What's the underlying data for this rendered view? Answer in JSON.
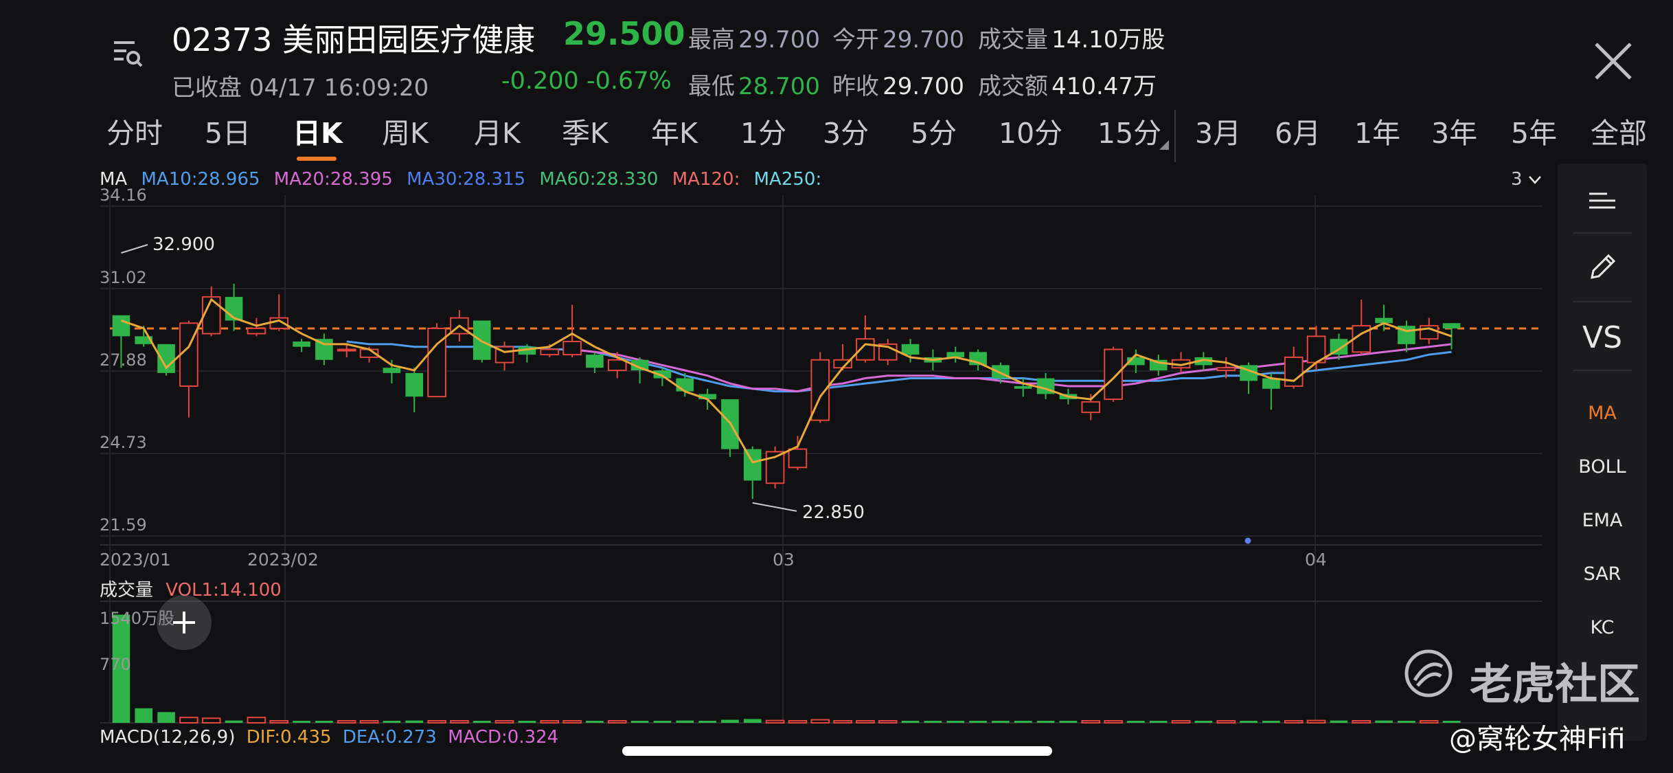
{
  "header": {
    "stock_title": "02373 美丽田园医疗健康",
    "price": "29.500",
    "status": "已收盘 04/17 16:09:20",
    "change": "-0.200  -0.67%",
    "high_label": "最高",
    "high_value": "29.700",
    "open_label": "今开",
    "open_value": "29.700",
    "volume_label": "成交量",
    "volume_value": "14.10万股",
    "low_label": "最低",
    "low_value": "28.700",
    "prev_close_label": "昨收",
    "prev_close_value": "29.700",
    "turnover_label": "成交额",
    "turnover_value": "410.47万",
    "icons": {
      "menu": "search-list-icon",
      "close": "close-icon"
    }
  },
  "tabs": [
    {
      "label": "分时"
    },
    {
      "label": "5日"
    },
    {
      "label": "日K",
      "active": true
    },
    {
      "label": "周K"
    },
    {
      "label": "月K"
    },
    {
      "label": "季K"
    },
    {
      "label": "年K"
    },
    {
      "label": "1分"
    },
    {
      "label": "3分"
    },
    {
      "label": "5分"
    },
    {
      "label": "10分"
    },
    {
      "label": "15分"
    },
    {
      "label": "3月"
    },
    {
      "label": "6月"
    },
    {
      "label": "1年"
    },
    {
      "label": "3年"
    },
    {
      "label": "5年"
    },
    {
      "label": "全部"
    }
  ],
  "ma_legend": {
    "label": "MA",
    "ma10": "MA10:28.965",
    "ma20": "MA20:28.395",
    "ma30": "MA30:28.315",
    "ma60": "MA60:28.330",
    "ma120": "MA120:",
    "ma250": "MA250:",
    "menu": "3",
    "colors": {
      "ma10": "#e8a93a",
      "ma20": "#d86ad8",
      "ma30": "#4f8fe8",
      "ma60": "#45c07a",
      "ma120": "#f06a6a",
      "ma250": "#6fd8e8"
    }
  },
  "tools": [
    {
      "label": "",
      "icon": "list-icon"
    },
    {
      "label": "",
      "icon": "pencil-icon"
    },
    {
      "label": "VS"
    },
    {
      "label": "MA",
      "active": true
    },
    {
      "label": "BOLL"
    },
    {
      "label": "EMA"
    },
    {
      "label": "SAR"
    },
    {
      "label": "KC"
    }
  ],
  "volume": {
    "label": "成交量",
    "vol1": "VOL1:14.100",
    "top_tick": "1540万股",
    "mid_tick": "770"
  },
  "macd": {
    "label": "MACD(12,26,9)",
    "dif": "DIF:0.435",
    "dea": "DEA:0.273",
    "macd": "MACD:0.324"
  },
  "watermark": "老虎社区",
  "credit": "@窝轮女神Fifi",
  "colors": {
    "up": "#e2463f",
    "down": "#2fb44a",
    "accent": "#f07a25",
    "background": "#111113"
  },
  "chart_data": {
    "type": "candlestick",
    "y_ticks": [
      "34.16",
      "31.02",
      "27.88",
      "24.73",
      "21.59"
    ],
    "ylim": [
      21.59,
      34.16
    ],
    "x_ticks": [
      "2023/01",
      "2023/02",
      "03",
      "04"
    ],
    "current_price_line": 29.5,
    "annotations": {
      "high": "32.900",
      "low": "22.850"
    },
    "candles": [
      [
        30.0,
        29.2,
        30.0,
        28.0
      ],
      [
        29.2,
        28.9,
        29.6,
        28.8
      ],
      [
        28.9,
        27.8,
        28.9,
        27.7
      ],
      [
        27.3,
        29.7,
        29.8,
        26.1
      ],
      [
        29.3,
        30.7,
        31.1,
        29.2
      ],
      [
        30.7,
        29.8,
        31.2,
        29.4
      ],
      [
        29.3,
        29.5,
        29.9,
        29.2
      ],
      [
        29.5,
        29.9,
        30.8,
        29.4
      ],
      [
        29.0,
        28.8,
        29.1,
        28.6
      ],
      [
        29.1,
        28.3,
        29.3,
        28.1
      ],
      [
        28.7,
        28.7,
        28.9,
        28.4
      ],
      [
        28.4,
        28.7,
        28.8,
        28.2
      ],
      [
        28.0,
        27.8,
        28.3,
        27.4
      ],
      [
        27.8,
        26.9,
        28.0,
        26.3
      ],
      [
        26.9,
        29.5,
        29.7,
        26.9
      ],
      [
        29.3,
        29.9,
        30.2,
        29.0
      ],
      [
        29.8,
        28.3,
        29.8,
        28.2
      ],
      [
        28.2,
        28.8,
        29.0,
        27.9
      ],
      [
        28.8,
        28.5,
        28.9,
        28.2
      ],
      [
        28.5,
        28.7,
        28.9,
        28.4
      ],
      [
        28.5,
        29.0,
        30.4,
        28.4
      ],
      [
        28.5,
        28.0,
        28.6,
        27.8
      ],
      [
        27.9,
        28.3,
        28.6,
        27.6
      ],
      [
        28.3,
        27.9,
        28.4,
        27.4
      ],
      [
        27.9,
        27.6,
        28.0,
        27.3
      ],
      [
        27.6,
        27.1,
        27.8,
        26.9
      ],
      [
        27.0,
        26.8,
        27.2,
        26.4
      ],
      [
        26.8,
        24.9,
        26.8,
        24.6
      ],
      [
        24.9,
        23.7,
        25.0,
        23.0
      ],
      [
        23.6,
        24.8,
        25.0,
        23.4
      ],
      [
        24.2,
        24.9,
        25.4,
        24.1
      ],
      [
        26.0,
        28.3,
        28.6,
        25.9
      ],
      [
        28.0,
        28.3,
        28.9,
        27.9
      ],
      [
        28.3,
        29.1,
        30.0,
        28.2
      ],
      [
        28.3,
        28.9,
        29.1,
        28.1
      ],
      [
        28.9,
        28.5,
        29.1,
        28.2
      ],
      [
        28.4,
        28.2,
        28.7,
        27.9
      ],
      [
        28.6,
        28.4,
        28.8,
        28.2
      ],
      [
        28.6,
        28.1,
        28.7,
        27.9
      ],
      [
        28.1,
        27.6,
        28.2,
        27.4
      ],
      [
        27.3,
        27.2,
        27.6,
        26.9
      ],
      [
        27.6,
        27.0,
        27.8,
        26.8
      ],
      [
        27.0,
        26.8,
        27.2,
        26.6
      ],
      [
        26.3,
        26.7,
        27.0,
        26.0
      ],
      [
        26.8,
        28.7,
        28.8,
        26.7
      ],
      [
        28.4,
        28.1,
        28.7,
        27.8
      ],
      [
        28.3,
        27.9,
        28.5,
        27.7
      ],
      [
        28.0,
        28.3,
        28.6,
        27.8
      ],
      [
        28.4,
        28.1,
        28.6,
        27.9
      ],
      [
        27.9,
        28.0,
        28.4,
        27.6
      ],
      [
        28.1,
        27.5,
        28.2,
        27.0
      ],
      [
        27.6,
        27.2,
        27.8,
        26.4
      ],
      [
        27.3,
        28.4,
        28.8,
        27.2
      ],
      [
        28.2,
        29.2,
        29.6,
        27.9
      ],
      [
        29.1,
        28.5,
        29.3,
        28.3
      ],
      [
        28.6,
        29.6,
        30.6,
        28.5
      ],
      [
        29.9,
        29.7,
        30.4,
        29.4
      ],
      [
        29.6,
        28.9,
        29.8,
        28.6
      ],
      [
        29.1,
        29.6,
        29.9,
        28.9
      ],
      [
        29.7,
        29.5,
        29.7,
        28.7
      ]
    ],
    "ma10": [
      29.8,
      29.5,
      28.0,
      28.8,
      30.6,
      29.9,
      29.6,
      29.8,
      29.3,
      28.9,
      28.9,
      28.7,
      28.1,
      27.9,
      28.9,
      29.6,
      29.0,
      28.6,
      28.7,
      28.8,
      29.3,
      28.8,
      28.4,
      28.0,
      27.7,
      27.1,
      26.8,
      25.9,
      24.4,
      24.6,
      25.0,
      26.9,
      28.0,
      28.9,
      28.8,
      28.4,
      28.3,
      28.4,
      28.2,
      27.8,
      27.4,
      27.2,
      26.9,
      26.8,
      27.6,
      28.5,
      28.2,
      28.1,
      28.3,
      28.2,
      27.9,
      27.6,
      27.5,
      28.2,
      28.7,
      29.3,
      29.7,
      29.4,
      29.5,
      29.2
    ],
    "ma20": [
      null,
      null,
      null,
      null,
      null,
      null,
      null,
      null,
      null,
      null,
      null,
      null,
      null,
      null,
      null,
      null,
      null,
      null,
      null,
      null,
      28.7,
      28.6,
      28.5,
      28.3,
      28.1,
      27.9,
      27.7,
      27.4,
      27.2,
      27.2,
      27.1,
      27.3,
      27.4,
      27.6,
      27.7,
      27.7,
      27.7,
      27.6,
      27.6,
      27.5,
      27.4,
      27.4,
      27.3,
      27.3,
      27.3,
      27.4,
      27.6,
      27.8,
      27.9,
      28.0,
      28.0,
      28.1,
      28.2,
      28.3,
      28.4,
      28.5,
      28.6,
      28.7,
      28.8,
      28.9
    ],
    "ma30": [
      null,
      null,
      null,
      null,
      null,
      null,
      null,
      null,
      null,
      null,
      29.0,
      28.9,
      28.9,
      28.8,
      28.8,
      28.8,
      28.8,
      28.8,
      28.8,
      28.7,
      28.7,
      28.6,
      28.4,
      28.2,
      28.0,
      27.7,
      27.5,
      27.3,
      27.2,
      27.1,
      27.1,
      27.2,
      27.3,
      27.4,
      27.5,
      27.6,
      27.6,
      27.6,
      27.6,
      27.6,
      27.6,
      27.5,
      27.5,
      27.5,
      27.5,
      27.5,
      27.5,
      27.6,
      27.6,
      27.7,
      27.7,
      27.8,
      27.8,
      27.9,
      28.0,
      28.1,
      28.2,
      28.3,
      28.5,
      28.6
    ],
    "volume": [
      14.1,
      1.9,
      1.4,
      0.7,
      0.6,
      0.3,
      0.7,
      0.2,
      0.1,
      0.2,
      0.1,
      0.2,
      0.1,
      0.3,
      0.2,
      0.2,
      0.1,
      0.1,
      0.2,
      0.1,
      0.2,
      0.1,
      0.1,
      0.1,
      0.2,
      0.3,
      0.2,
      0.4,
      0.5,
      0.3,
      0.2,
      0.4,
      0.2,
      0.2,
      0.1,
      0.2,
      0.1,
      0.2,
      0.1,
      0.1,
      0.1,
      0.1,
      0.1,
      0.1,
      0.1,
      0.1,
      0.1,
      0.1,
      0.2,
      0.1,
      0.1,
      0.1,
      0.1,
      0.3,
      0.3,
      0.2,
      0.3,
      0.2,
      0.2,
      0.1
    ]
  }
}
